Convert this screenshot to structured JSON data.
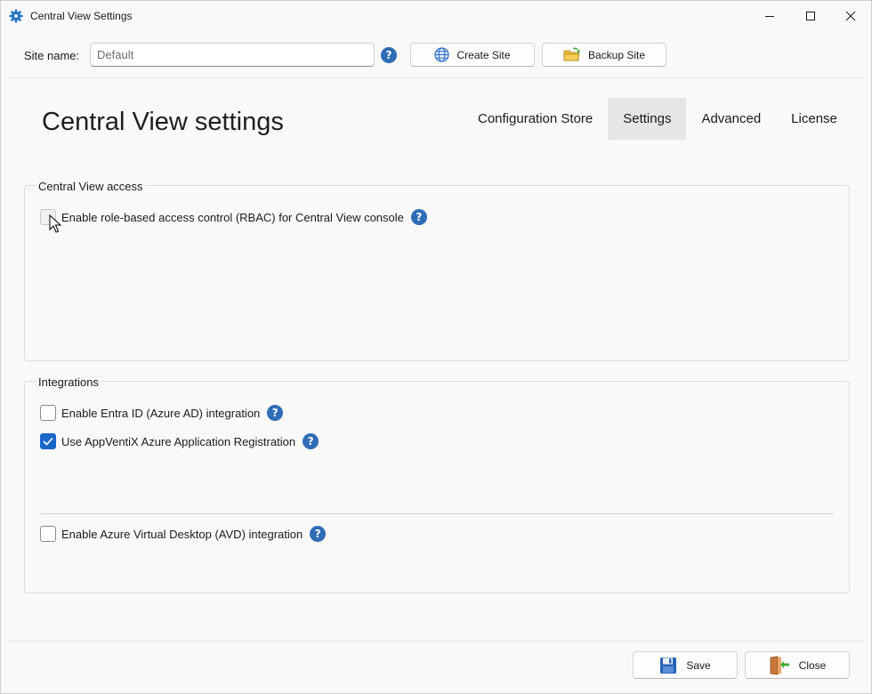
{
  "window": {
    "title": "Central View Settings",
    "icon": "gear-icon"
  },
  "toolbar": {
    "site_label": "Site name:",
    "site_value": "Default",
    "create_site_label": "Create Site",
    "backup_site_label": "Backup Site"
  },
  "header": {
    "title": "Central View settings",
    "tabs": [
      {
        "label": "Configuration Store",
        "active": false
      },
      {
        "label": "Settings",
        "active": true
      },
      {
        "label": "Advanced",
        "active": false
      },
      {
        "label": "License",
        "active": false
      }
    ]
  },
  "groups": {
    "access": {
      "title": "Central View access",
      "rbac_label": "Enable role-based access control (RBAC) for Central View console",
      "rbac_checked": false
    },
    "integrations": {
      "title": "Integrations",
      "entra_label": "Enable Entra ID (Azure AD) integration",
      "entra_checked": false,
      "appventix_label": "Use AppVentiX Azure Application Registration",
      "appventix_checked": true,
      "avd_label": "Enable Azure Virtual Desktop (AVD) integration",
      "avd_checked": false
    }
  },
  "footer": {
    "save_label": "Save",
    "close_label": "Close"
  },
  "colors": {
    "accent": "#1b66c9",
    "help": "#2f6db5",
    "active_tab": "#e6e6e6"
  }
}
